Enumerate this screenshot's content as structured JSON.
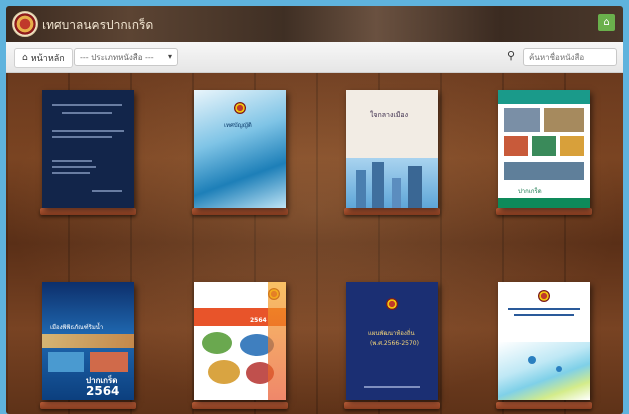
{
  "app": {
    "title": "เทศบาลนครปากเกร็ด"
  },
  "nav": {
    "home_label": "หน้าหลัก",
    "category_select": {
      "selected": "--- ประเภทหนังสือ ---"
    },
    "search": {
      "placeholder": "ค้นหาชื่อหนังสือ"
    }
  },
  "cover_texts": {
    "b2": "เทศบัญญัติ",
    "b3": "ใจกลางเมือง",
    "b4": "ปากเกร็ด",
    "b5_small": "เมืองพิพิธภัณฑ์ริมน้ำ",
    "b5_big": "ปากเกร็ด",
    "b5_year": "2564",
    "b6_year": "2564",
    "b7": "แผนพัฒนาท้องถิ่น",
    "b7_sub": "(พ.ศ.2566-2570)"
  },
  "colors": {
    "accent_green": "#6ab04c",
    "topbar": "#3f2f24",
    "shelf_wood": "#6b3a1e",
    "ledge": "#b0532f"
  }
}
